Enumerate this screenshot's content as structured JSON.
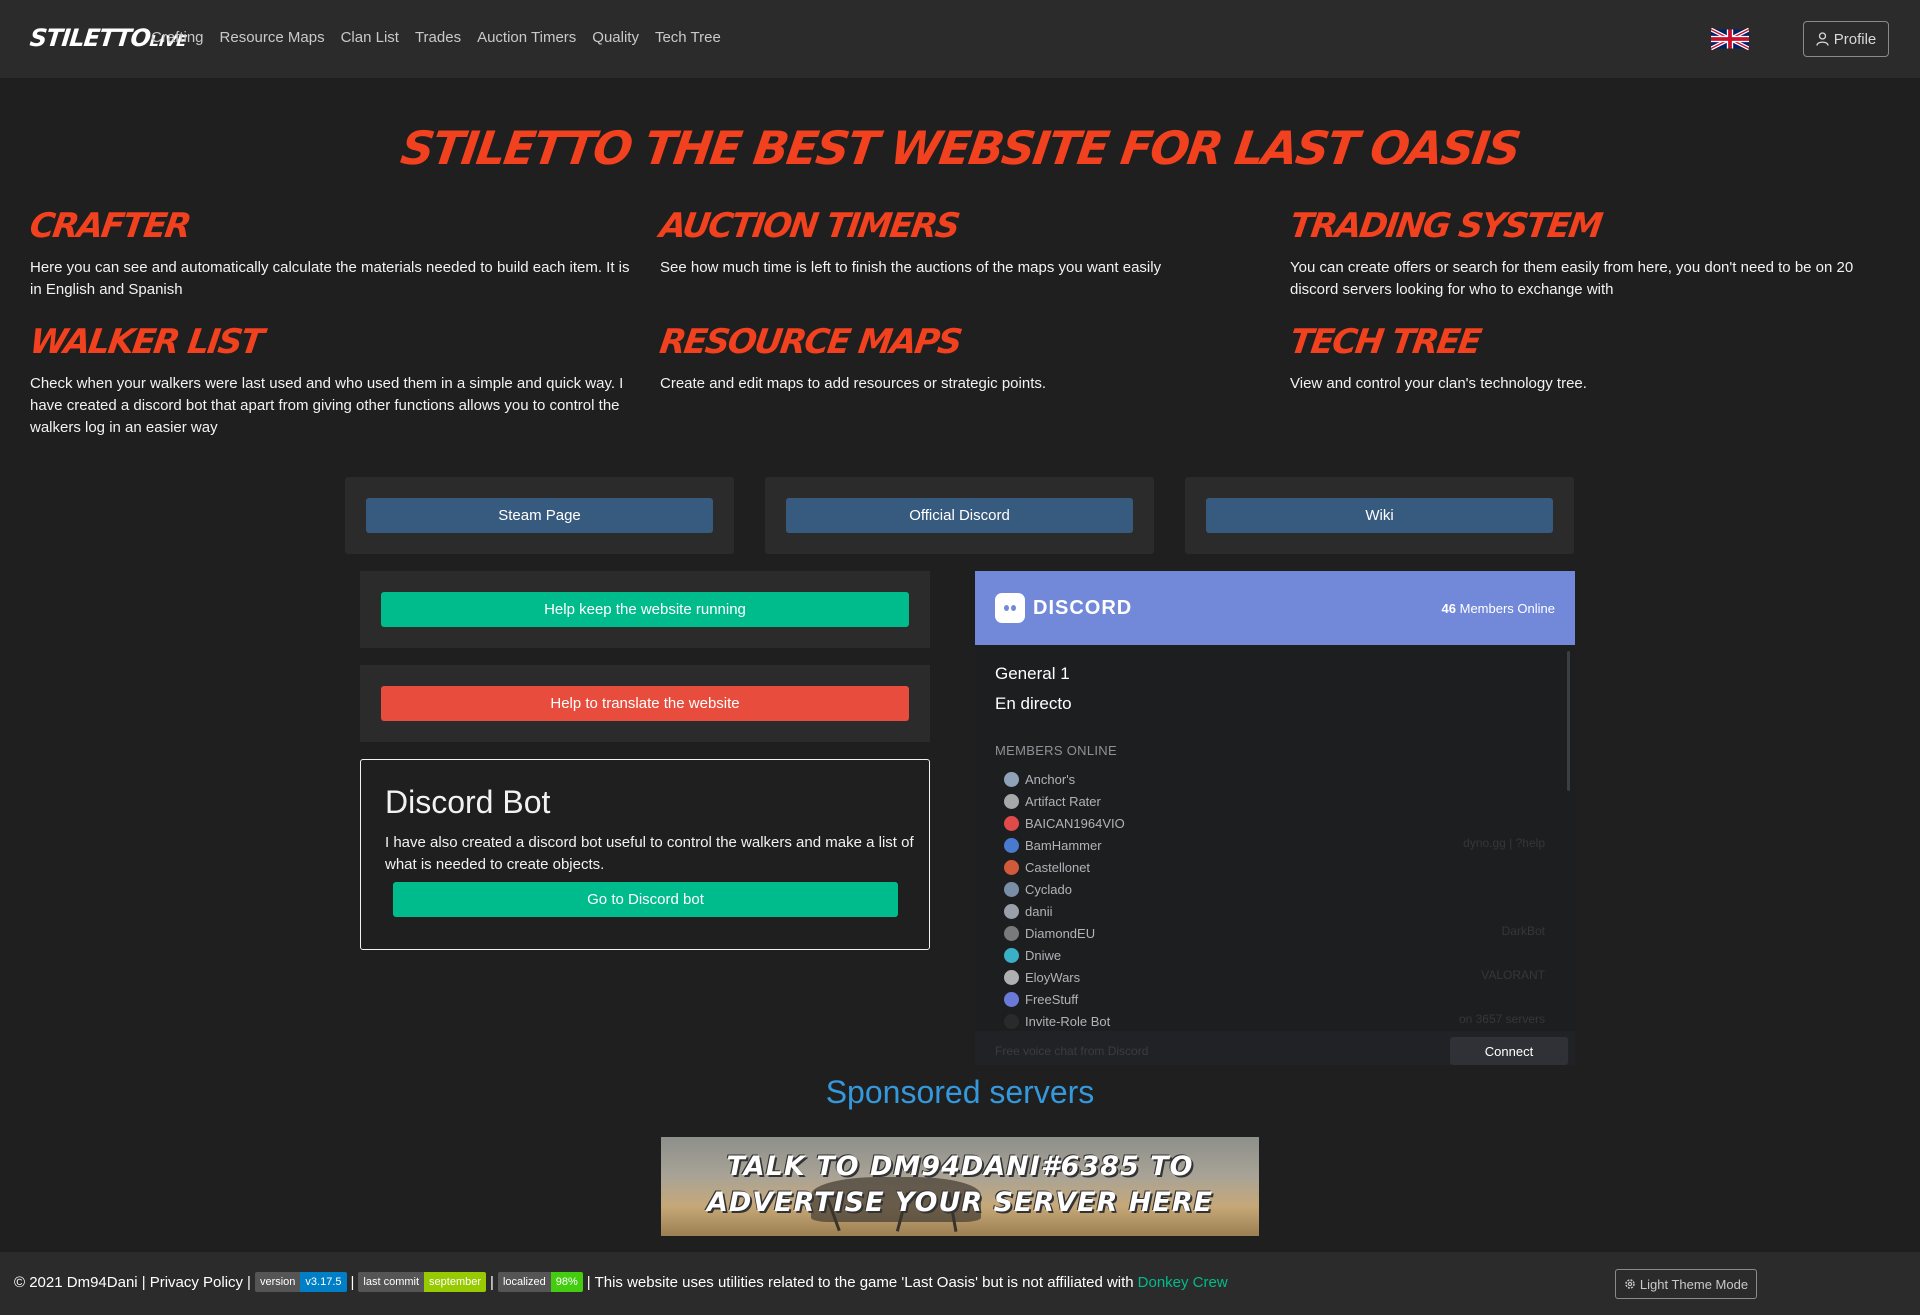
{
  "nav": {
    "logo_main": "STILETTO",
    "logo_sub": "LIVE",
    "links": [
      "Crafting",
      "Resource Maps",
      "Clan List",
      "Trades",
      "Auction Timers",
      "Quality",
      "Tech Tree"
    ],
    "profile_label": "Profile"
  },
  "hero": {
    "title": "Stiletto the best website for Last Oasis"
  },
  "features": [
    {
      "title": "Crafter",
      "text": "Here you can see and automatically calculate the materials needed to build each item. It is in English and Spanish"
    },
    {
      "title": "Auction timers",
      "text": "See how much time is left to finish the auctions of the maps you want easily"
    },
    {
      "title": "Trading System",
      "text": "You can create offers or search for them easily from here, you don't need to be on 20 discord servers looking for who to exchange with"
    },
    {
      "title": "Walker List",
      "text": "Check when your walkers were last used and who used them in a simple and quick way. I have created a discord bot that apart from giving other functions allows you to control the walkers log in an easier way"
    },
    {
      "title": "Resource Maps",
      "text": "Create and edit maps to add resources or strategic points."
    },
    {
      "title": "Tech Tree",
      "text": "View and control your clan's technology tree."
    }
  ],
  "links": {
    "steam": "Steam Page",
    "discord": "Official Discord",
    "wiki": "Wiki"
  },
  "support": {
    "donate": "Help keep the website running",
    "translate": "Help to translate the website"
  },
  "bot": {
    "title": "Discord Bot",
    "text": "I have also created a discord bot useful to control the walkers and make a list of what is needed to create objects.",
    "button": "Go to Discord bot"
  },
  "discord_widget": {
    "brand": "DISCORD",
    "members_count": "46",
    "members_label": "Members Online",
    "channels": [
      "General 1",
      "En directo"
    ],
    "members_title": "MEMBERS ONLINE",
    "members": [
      {
        "name": "Anchor's",
        "color": "#8fa3b8"
      },
      {
        "name": "Artifact Rater",
        "color": "#a8a8a8"
      },
      {
        "name": "BAICAN1964VIO",
        "color": "#e04a4a"
      },
      {
        "name": "BamHammer",
        "color": "#4a7ad0"
      },
      {
        "name": "Castellonet",
        "color": "#d05a3a"
      },
      {
        "name": "Cyclado",
        "color": "#7a8ea8"
      },
      {
        "name": "danii",
        "color": "#9aa0aa"
      },
      {
        "name": "DiamondEU",
        "color": "#7a7a7a"
      },
      {
        "name": "Dniwe",
        "color": "#3ab0c8"
      },
      {
        "name": "EloyWars",
        "color": "#b0b0b0"
      },
      {
        "name": "FreeStuff",
        "color": "#6a7ad8"
      },
      {
        "name": "Invite-Role Bot",
        "color": "#2a2a2a"
      }
    ],
    "faded": [
      "dyno.gg | ?help",
      "DarkBot",
      "VALORANT",
      "on 3657 servers"
    ],
    "footer_text": "Free voice chat from Discord",
    "connect": "Connect"
  },
  "sponsored": {
    "title": "Sponsored servers",
    "banner_text": "Talk to Dm94Dani#6385 to advertise your server here"
  },
  "footer": {
    "copyright": "© 2021 Dm94Dani |",
    "privacy": "Privacy Policy",
    "sep": "|",
    "badges": [
      {
        "key": "version",
        "value": "v3.17.5"
      },
      {
        "key": "last commit",
        "value": "september"
      },
      {
        "key": "localized",
        "value": "98%"
      }
    ],
    "disclaimer": "| This website uses utilities related to the game 'Last Oasis' but is not affiliated with",
    "company": "Donkey Crew",
    "theme_button": "Light Theme Mode"
  },
  "colors": {
    "accent_red": "#f2411e",
    "primary": "#375a7f",
    "success": "#00bc8c",
    "danger": "#e74c3c",
    "discord": "#7289da",
    "info": "#3498db"
  }
}
